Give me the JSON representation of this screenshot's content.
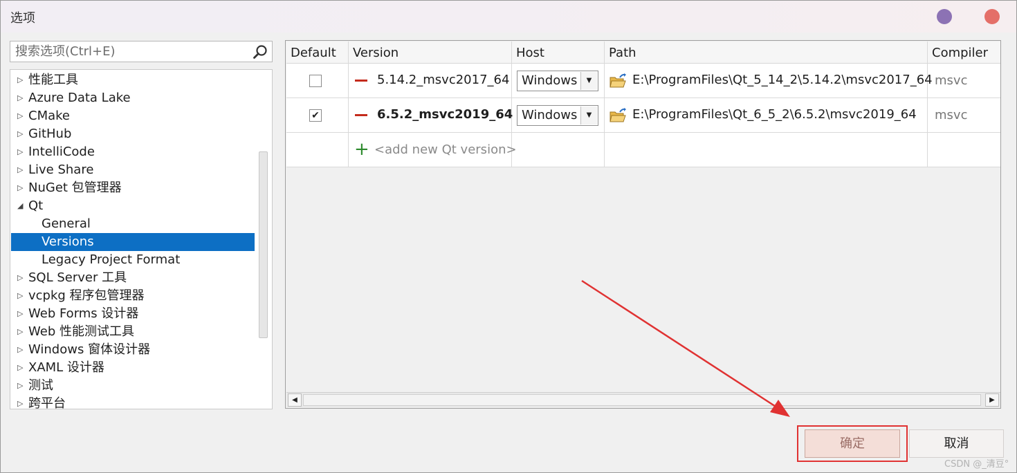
{
  "window": {
    "title": "选项"
  },
  "search": {
    "placeholder": "搜索选项(Ctrl+E)"
  },
  "tree": {
    "items": [
      {
        "label": "性能工具",
        "expanded": false
      },
      {
        "label": "Azure Data Lake",
        "expanded": false
      },
      {
        "label": "CMake",
        "expanded": false
      },
      {
        "label": "GitHub",
        "expanded": false
      },
      {
        "label": "IntelliCode",
        "expanded": false
      },
      {
        "label": "Live Share",
        "expanded": false
      },
      {
        "label": "NuGet 包管理器",
        "expanded": false
      },
      {
        "label": "Qt",
        "expanded": true
      },
      {
        "label": "General",
        "child": true
      },
      {
        "label": "Versions",
        "child": true,
        "selected": true
      },
      {
        "label": "Legacy Project Format",
        "child": true
      },
      {
        "label": "SQL Server 工具",
        "expanded": false
      },
      {
        "label": "vcpkg 程序包管理器",
        "expanded": false
      },
      {
        "label": "Web Forms 设计器",
        "expanded": false
      },
      {
        "label": "Web 性能测试工具",
        "expanded": false
      },
      {
        "label": "Windows 窗体设计器",
        "expanded": false
      },
      {
        "label": "XAML 设计器",
        "expanded": false
      },
      {
        "label": "测试",
        "expanded": false
      },
      {
        "label": "跨平台",
        "expanded": false
      }
    ]
  },
  "grid": {
    "headers": {
      "default": "Default",
      "version": "Version",
      "host": "Host",
      "path": "Path",
      "compiler": "Compiler"
    },
    "rows": [
      {
        "default": false,
        "version": "5.14.2_msvc2017_64",
        "bold": false,
        "host": "Windows",
        "path": "E:\\ProgramFiles\\Qt_5_14_2\\5.14.2\\msvc2017_64",
        "compiler": "msvc"
      },
      {
        "default": true,
        "version": "6.5.2_msvc2019_64",
        "bold": true,
        "host": "Windows",
        "path": "E:\\ProgramFiles\\Qt_6_5_2\\6.5.2\\msvc2019_64",
        "compiler": "msvc"
      }
    ],
    "add_row": {
      "label": "<add new Qt version>"
    }
  },
  "buttons": {
    "ok": "确定",
    "cancel": "取消"
  },
  "icons": {
    "search": "search-icon",
    "remove": "remove-icon",
    "folder": "open-folder-icon",
    "add": "plus-icon",
    "dropdown": "dropdown-arrow-icon"
  },
  "colors": {
    "selection": "#0d6fc4",
    "remove": "#c42b1c",
    "add": "#2d8a2d",
    "annotation": "#e03232"
  },
  "watermark": "CSDN @_清豆°"
}
